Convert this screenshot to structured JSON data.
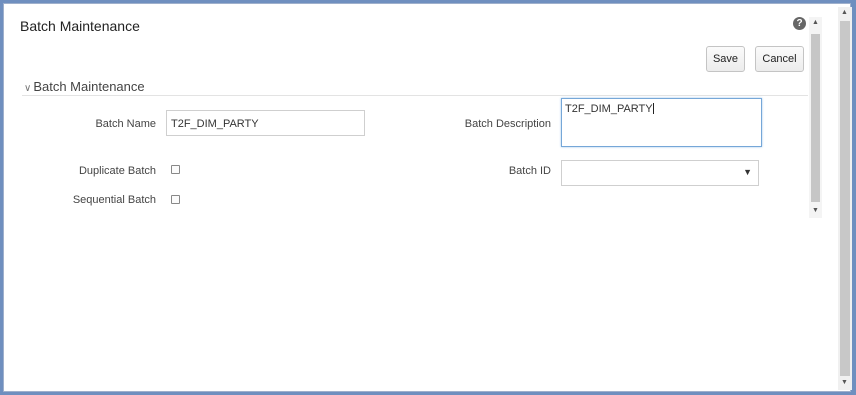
{
  "header": {
    "title": "Batch Maintenance",
    "help_icon": "question-circle-icon",
    "help_glyph": "?"
  },
  "toolbar": {
    "save_label": "Save",
    "cancel_label": "Cancel"
  },
  "section": {
    "title": "Batch Maintenance",
    "chevron_icon": "chevron-down-icon"
  },
  "form": {
    "batch_name_label": "Batch Name",
    "batch_name_value": "T2F_DIM_PARTY",
    "batch_description_label": "Batch Description",
    "batch_description_value": "T2F_DIM_PARTY",
    "duplicate_batch_label": "Duplicate Batch",
    "duplicate_batch_checked": false,
    "sequential_batch_label": "Sequential Batch",
    "sequential_batch_checked": false,
    "batch_id_label": "Batch ID",
    "batch_id_value": ""
  }
}
